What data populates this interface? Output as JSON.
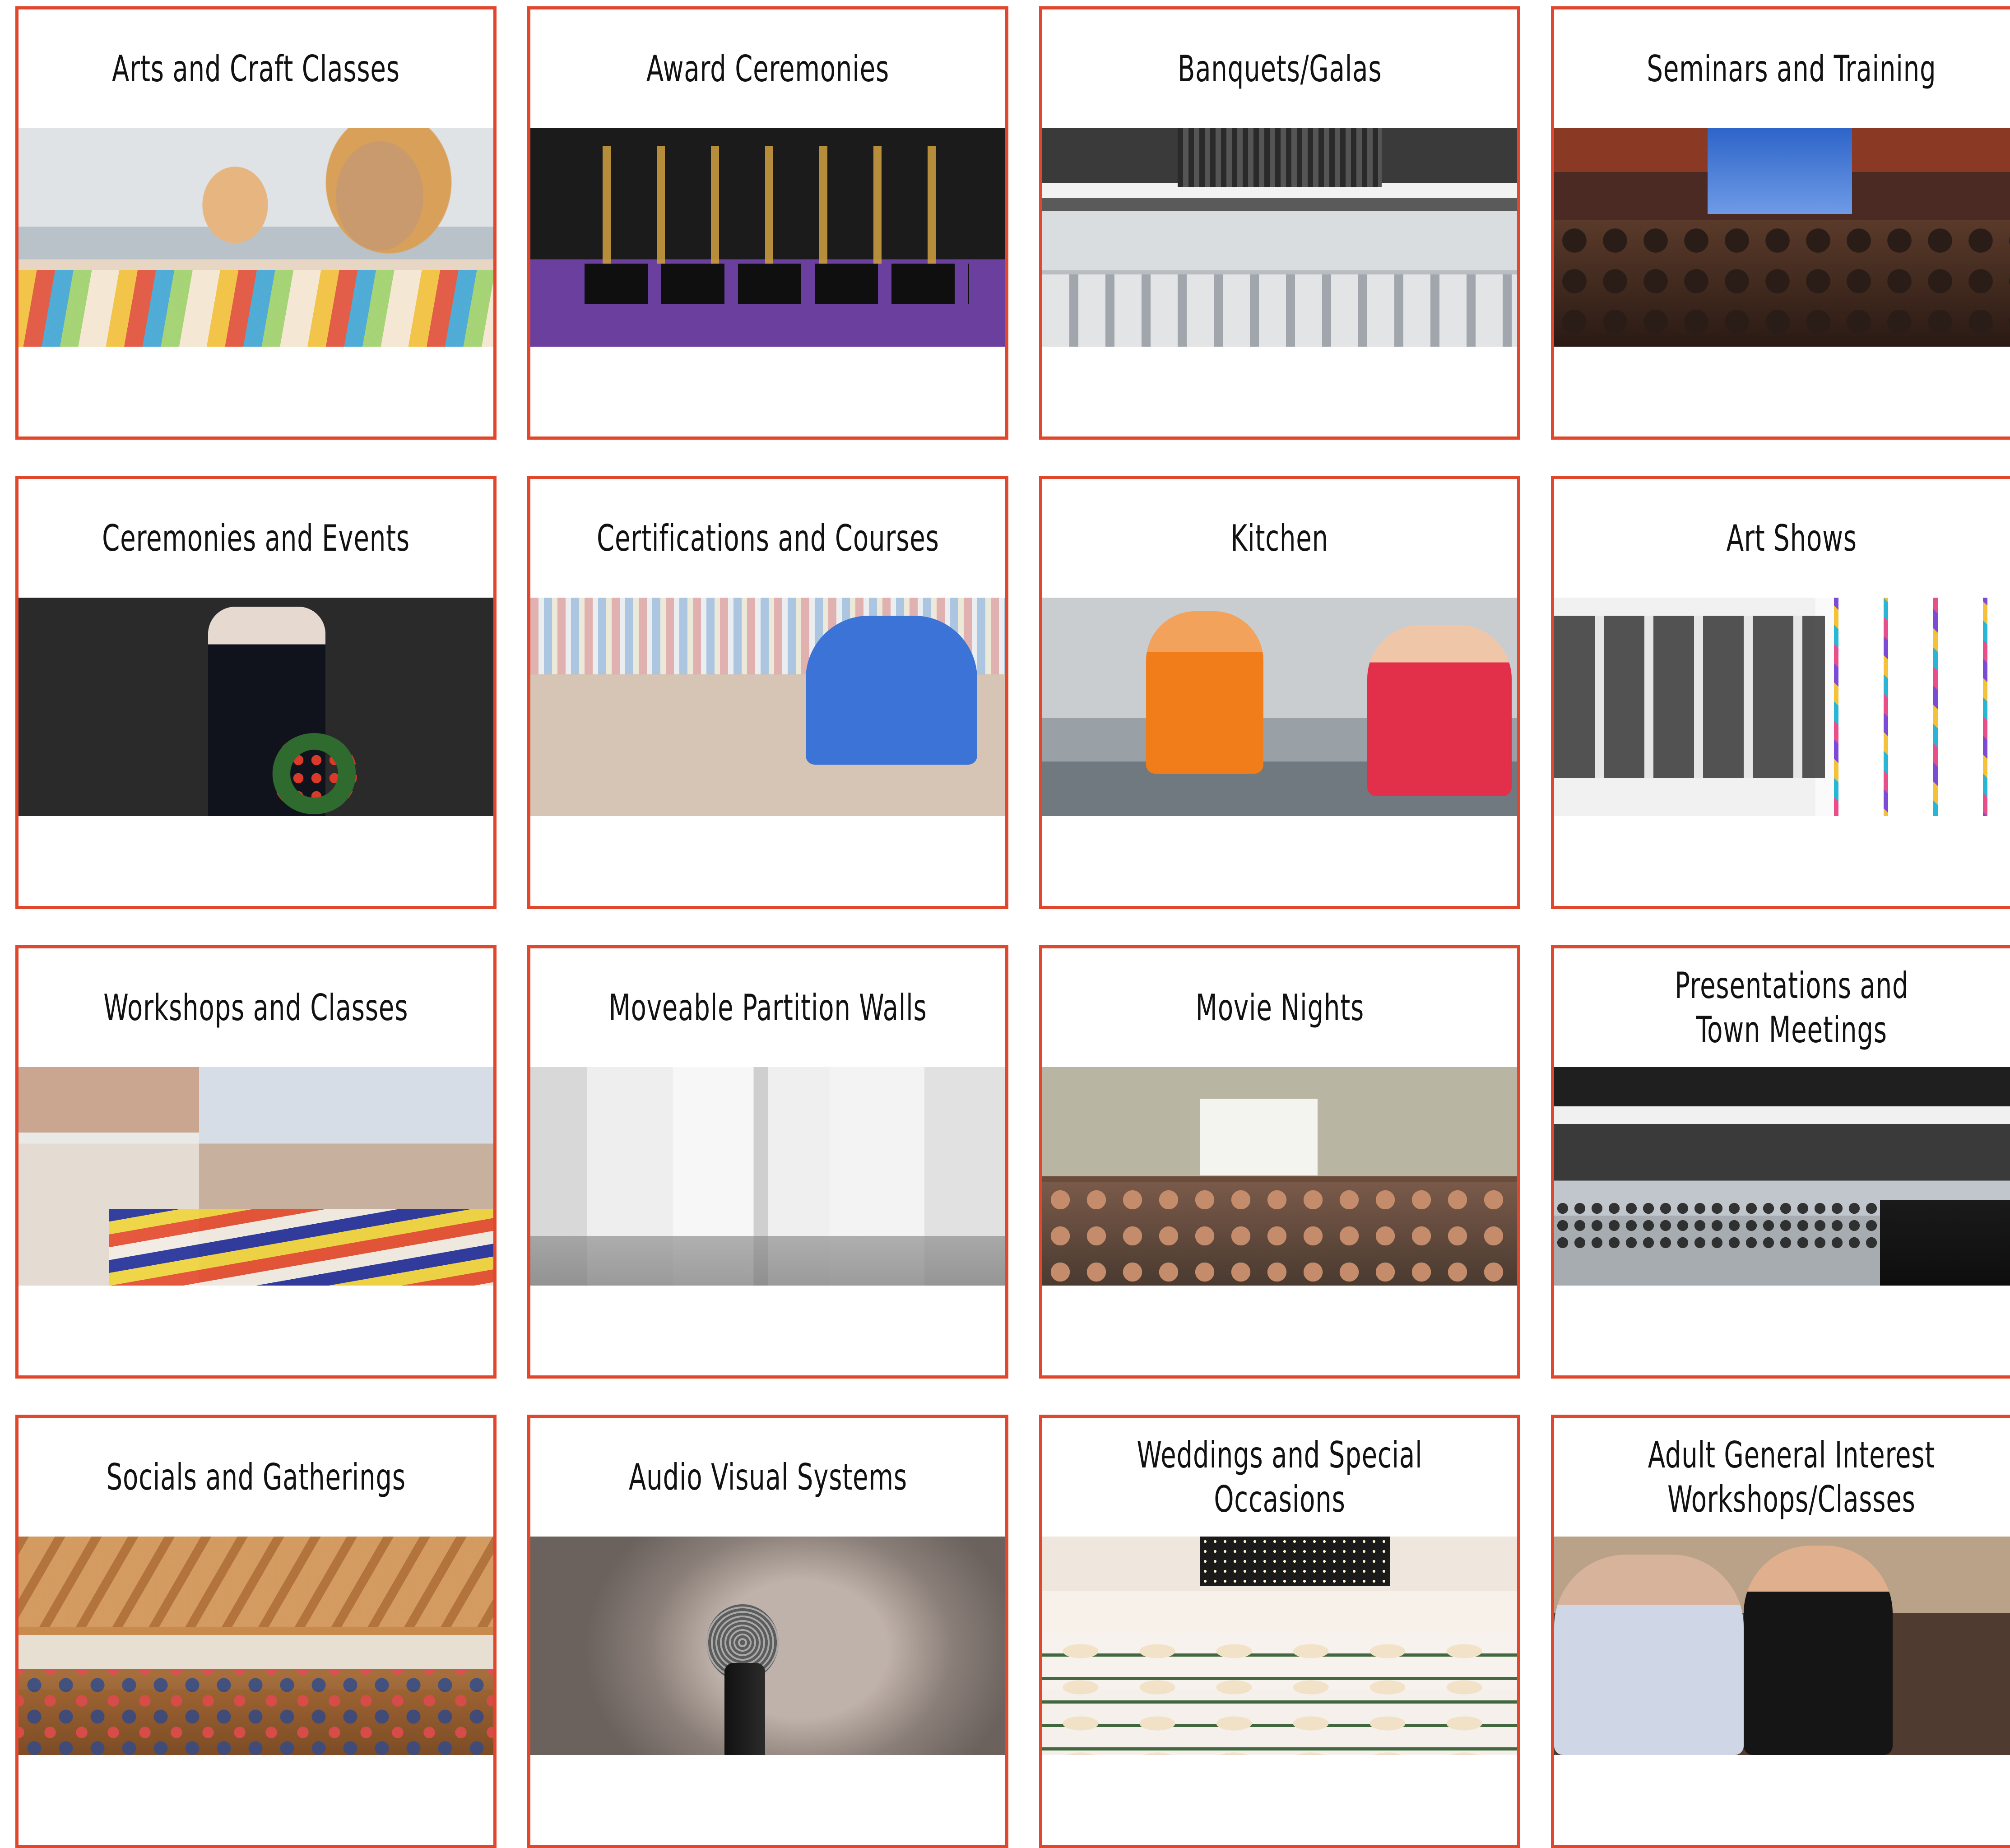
{
  "cards": [
    {
      "title": "Arts and Craft Classes",
      "photo": "children-crafting-photo"
    },
    {
      "title": "Award Ceremonies",
      "photo": "trophies-photo"
    },
    {
      "title": "Banquets/Galas",
      "photo": "banquet-hall-photo"
    },
    {
      "title": "Seminars and Training",
      "photo": "seminar-audience-photo"
    },
    {
      "title": "Ceremonies and Events",
      "photo": "veterans-ceremony-photo"
    },
    {
      "title": "Certifications and Courses",
      "photo": "group-study-photo"
    },
    {
      "title": "Kitchen",
      "photo": "community-kitchen-photo"
    },
    {
      "title": "Art Shows",
      "photo": "art-gallery-photo"
    },
    {
      "title": "Workshops and Classes",
      "photo": "painting-class-photo"
    },
    {
      "title": "Moveable Partition Walls",
      "photo": "partition-walls-photo"
    },
    {
      "title": "Movie Nights",
      "photo": "movie-night-photo"
    },
    {
      "title": "Presentations and\nTown Meetings",
      "photo": "town-meeting-photo"
    },
    {
      "title": "Socials and Gatherings",
      "photo": "social-gathering-photo"
    },
    {
      "title": "Audio Visual Systems",
      "photo": "microphone-photo"
    },
    {
      "title": "Weddings and Special Occasions",
      "photo": "wedding-reception-photo"
    },
    {
      "title": "Adult General Interest\nWorkshops/Classes",
      "photo": "ukulele-class-photo"
    }
  ],
  "colors": {
    "card_border": "#e0472c",
    "title_text": "#111111",
    "background": "#ffffff"
  }
}
